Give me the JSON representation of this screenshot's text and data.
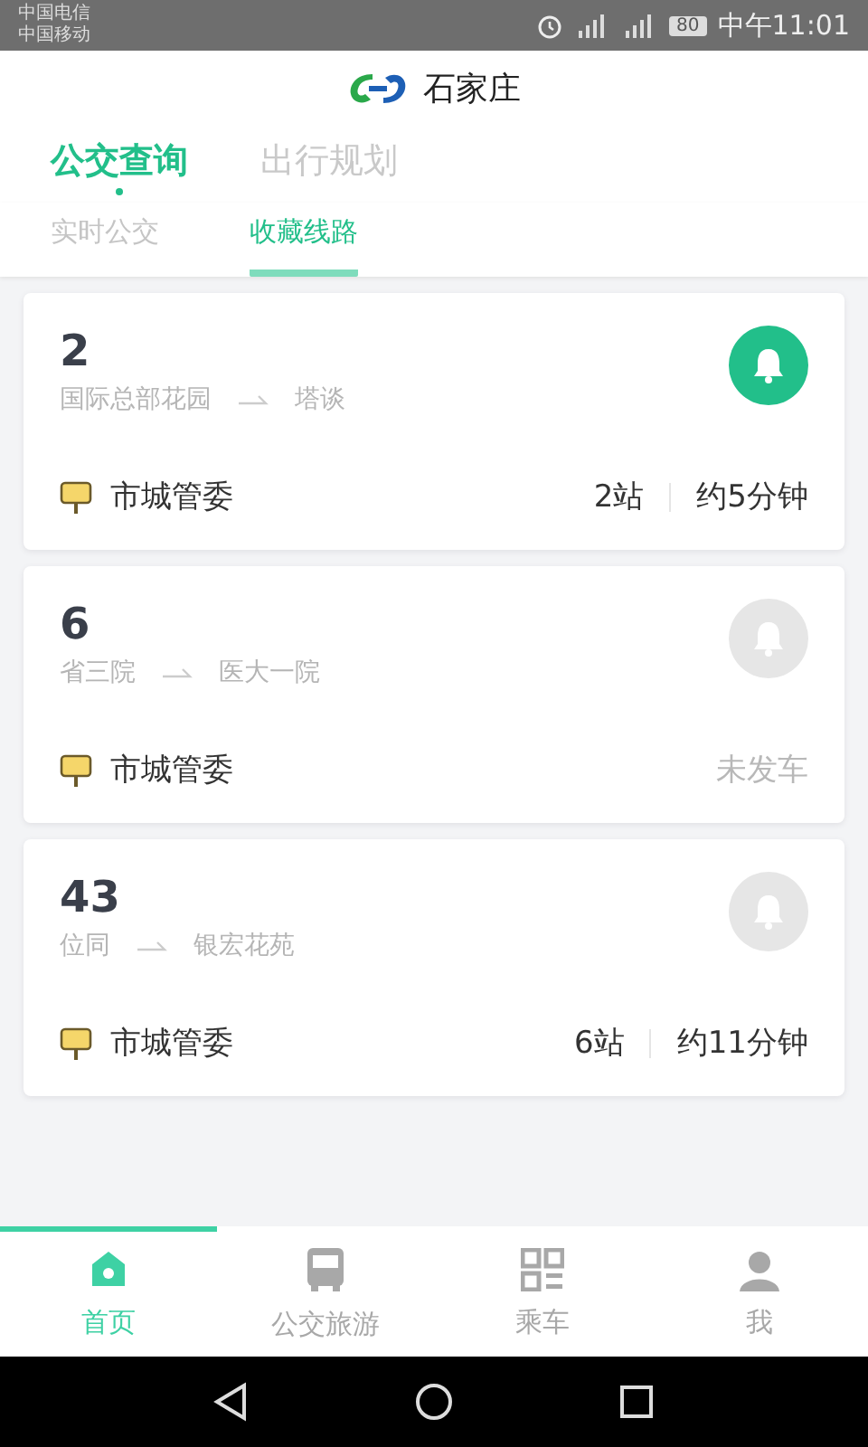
{
  "status_bar": {
    "carriers": [
      "中国电信",
      "中国移动"
    ],
    "battery": "80",
    "time": "中午11:01"
  },
  "header": {
    "title": "石家庄"
  },
  "tabs": [
    {
      "label": "公交查询",
      "selected": true
    },
    {
      "label": "出行规划",
      "selected": false
    }
  ],
  "subtabs": [
    {
      "label": "实时公交",
      "selected": false
    },
    {
      "label": "收藏线路",
      "selected": true
    }
  ],
  "routes": [
    {
      "number": "2",
      "from": "国际总部花园",
      "to": "塔谈",
      "station": "市城管委",
      "alert_on": true,
      "kind": "arriving",
      "stops": "2站",
      "eta": "约5分钟"
    },
    {
      "number": "6",
      "from": "省三院",
      "to": "医大一院",
      "station": "市城管委",
      "alert_on": false,
      "kind": "not_departed",
      "status": "未发车"
    },
    {
      "number": "43",
      "from": "位同",
      "to": "银宏花苑",
      "station": "市城管委",
      "alert_on": false,
      "kind": "arriving",
      "stops": "6站",
      "eta": "约11分钟"
    }
  ],
  "bottom_nav": [
    {
      "label": "首页",
      "kind": "home",
      "selected": true
    },
    {
      "label": "公交旅游",
      "kind": "bus",
      "selected": false
    },
    {
      "label": "乘车",
      "kind": "qr",
      "selected": false
    },
    {
      "label": "我",
      "kind": "person",
      "selected": false
    }
  ]
}
